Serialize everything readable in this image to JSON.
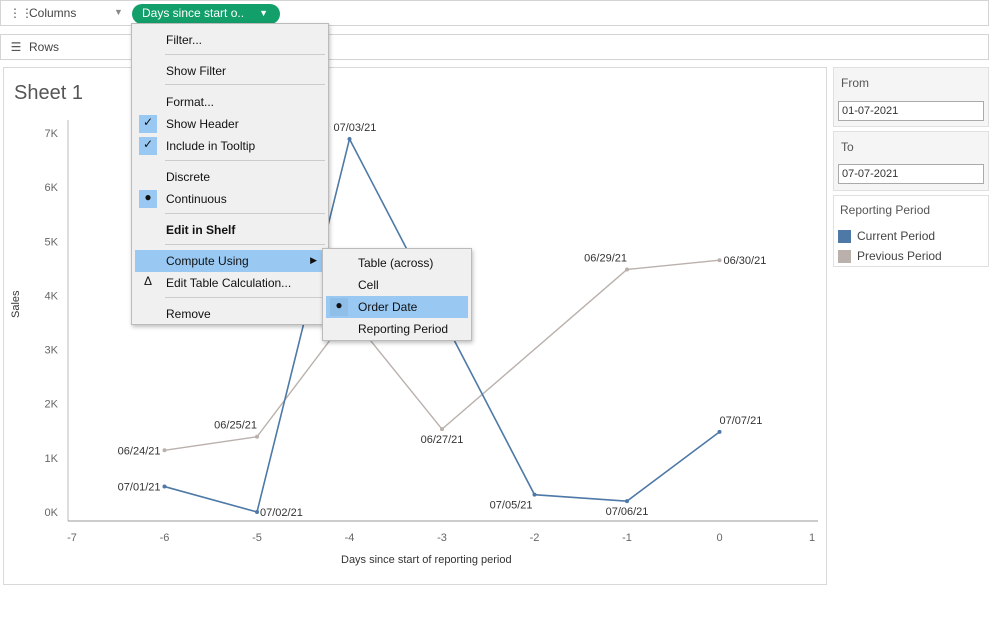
{
  "shelves": {
    "columns_label": "Columns",
    "columns_pill": "Days since start o..",
    "rows_label": "Rows"
  },
  "sheet": {
    "title": "Sheet 1"
  },
  "filters": {
    "from_label": "From",
    "from_value": "01-07-2021",
    "to_label": "To",
    "to_value": "07-07-2021"
  },
  "legend": {
    "title": "Reporting Period",
    "items": [
      {
        "label": "Current Period",
        "color": "#4e79a7"
      },
      {
        "label": "Previous Period",
        "color": "#bab0ac"
      }
    ]
  },
  "context_menu": {
    "items": [
      {
        "label": "Filter..."
      },
      {
        "label": "Show Filter"
      },
      {
        "label": "Format..."
      },
      {
        "label": "Show Header",
        "checked": true
      },
      {
        "label": "Include in Tooltip",
        "checked": true
      },
      {
        "label": "Discrete"
      },
      {
        "label": "Continuous",
        "selected": true
      },
      {
        "label": "Edit in Shelf"
      },
      {
        "label": "Compute Using",
        "submenu": true,
        "highlighted": true
      },
      {
        "label": "Edit Table Calculation..."
      },
      {
        "label": "Remove"
      }
    ],
    "submenu": [
      {
        "label": "Table (across)"
      },
      {
        "label": "Cell"
      },
      {
        "label": "Order Date",
        "selected": true
      },
      {
        "label": "Reporting Period"
      }
    ]
  },
  "chart_data": {
    "type": "line",
    "xlabel": "Days since start of reporting period",
    "ylabel": "Sales",
    "xlim": [
      -7,
      1
    ],
    "ylim": [
      0,
      7000
    ],
    "x_ticks": [
      "-7",
      "-6",
      "-5",
      "-4",
      "-3",
      "-2",
      "-1",
      "0",
      "1"
    ],
    "y_ticks": [
      "0K",
      "1K",
      "2K",
      "3K",
      "4K",
      "5K",
      "6K",
      "7K"
    ],
    "grid": false,
    "series": [
      {
        "name": "Current Period",
        "color": "#4e79a7",
        "points": [
          {
            "x": -6,
            "y": 470,
            "label": "07/01/21"
          },
          {
            "x": -5,
            "y": 0,
            "label": "07/02/21"
          },
          {
            "x": -4,
            "y": 6890,
            "label": "07/03/21"
          },
          {
            "x": -2,
            "y": 320,
            "label": "07/05/21"
          },
          {
            "x": -1,
            "y": 200,
            "label": "07/06/21"
          },
          {
            "x": 0,
            "y": 1480,
            "label": "07/07/21"
          }
        ]
      },
      {
        "name": "Previous Period",
        "color": "#bab0ac",
        "points": [
          {
            "x": -6,
            "y": 1140,
            "label": "06/24/21"
          },
          {
            "x": -5,
            "y": 1390,
            "label": "06/25/21"
          },
          {
            "x": -4,
            "y": 3650,
            "label": ""
          },
          {
            "x": -3,
            "y": 1530,
            "label": "06/27/21"
          },
          {
            "x": -1,
            "y": 4480,
            "label": "06/29/21"
          },
          {
            "x": 0,
            "y": 4650,
            "label": "06/30/21"
          }
        ]
      }
    ]
  }
}
